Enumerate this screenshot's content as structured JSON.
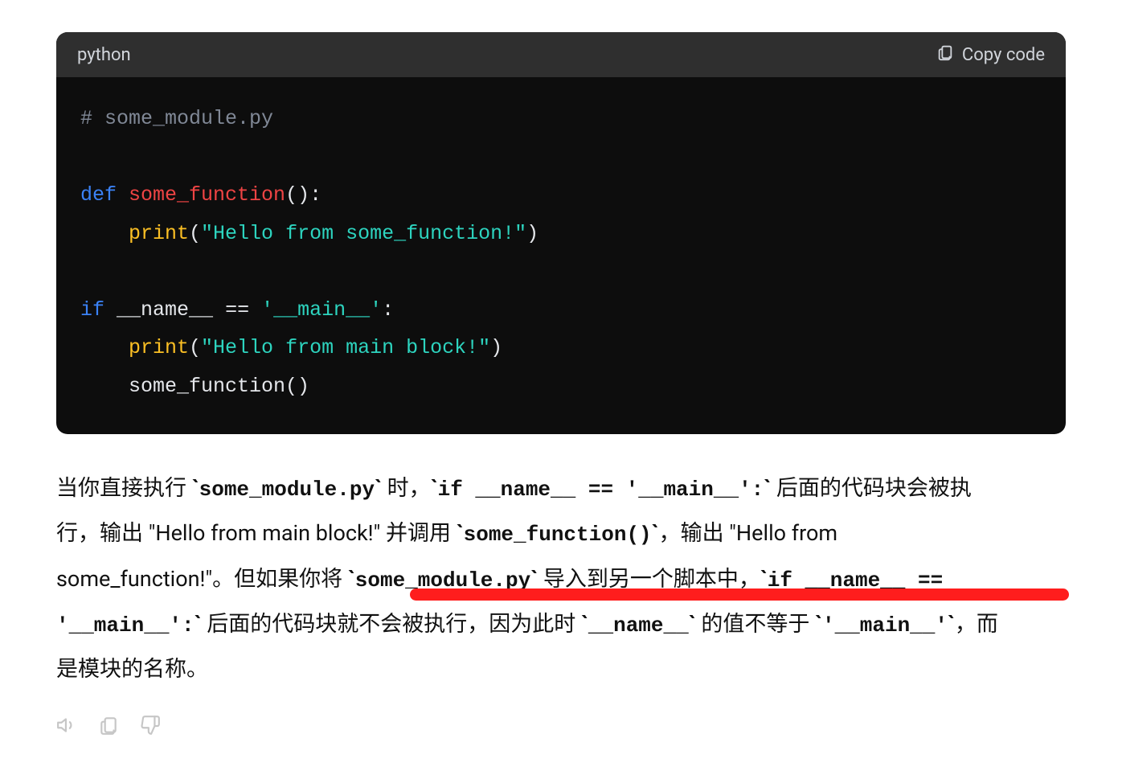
{
  "code_block": {
    "language_label": "python",
    "copy_label": "Copy code",
    "code": {
      "comment": "# some_module.py",
      "def_kw": "def",
      "fn_name": "some_function",
      "print_fn": "print",
      "hello_fn_str": "\"Hello from some_function!\"",
      "if_kw": "if",
      "name_dunder": "__name__",
      "eq_op": "==",
      "main_str": "'__main__'",
      "colon": ":",
      "hello_main_str": "\"Hello from main block!\"",
      "call_fn": "some_function()"
    }
  },
  "explanation": {
    "txt1": "当你直接执行 ",
    "code1": "some_module.py",
    "txt2": " 时，",
    "code2": "if __name__ == '__main__':",
    "txt3": " 后面的代码块会被执行，输出 \"Hello from main block!\" 并调用 ",
    "code3": "some_function()",
    "txt4": "，输出 \"Hello from some_function!\"。但如果你将 ",
    "code4": "some_module.py",
    "txt5": " 导入到另一个脚本中，",
    "code5": "if __name__ == '__main__':",
    "txt6": " 后面的代码块就不会被执行，因为此时 ",
    "code6": "__name__",
    "txt7": " 的值不等于 ",
    "code7": "'__main__'",
    "txt8": "，而是模块的名称。"
  },
  "icons": {
    "clipboard": "clipboard-icon",
    "speaker": "speaker-icon",
    "copy_response": "clipboard-icon",
    "thumbs_down": "thumbs-down-icon"
  }
}
